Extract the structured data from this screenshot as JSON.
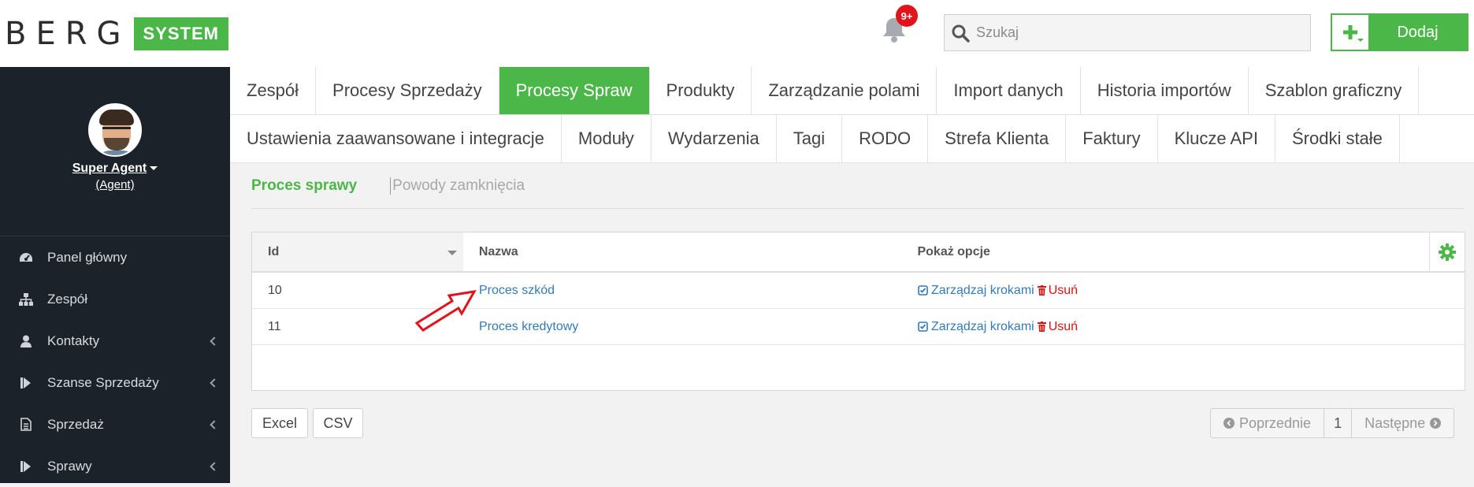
{
  "logo": {
    "part1": "BERG",
    "part2": "SYSTEM"
  },
  "user": {
    "name": "Super Agent",
    "role": "(Agent)"
  },
  "sidebar": {
    "items": [
      {
        "label": "Panel główny",
        "icon": "dashboard-icon"
      },
      {
        "label": "Zespół",
        "icon": "sitemap-icon"
      },
      {
        "label": "Kontakty",
        "icon": "user-icon"
      },
      {
        "label": "Szanse Sprzedaży",
        "icon": "step-forward-icon"
      },
      {
        "label": "Sprzedaż",
        "icon": "document-icon"
      },
      {
        "label": "Sprawy",
        "icon": "step-forward-icon"
      }
    ]
  },
  "topbar": {
    "notifications_badge": "9+",
    "search_placeholder": "Szukaj",
    "add_label": "Dodaj"
  },
  "tabs": {
    "row1": [
      "Zespół",
      "Procesy Sprzedaży",
      "Procesy Spraw",
      "Produkty",
      "Zarządzanie polami",
      "Import danych",
      "Historia importów",
      "Szablon graficzny"
    ],
    "row2": [
      "Ustawienia zaawansowane i integracje",
      "Moduły",
      "Wydarzenia",
      "Tagi",
      "RODO",
      "Strefa Klienta",
      "Faktury",
      "Klucze API",
      "Środki stałe"
    ],
    "active": "Procesy Spraw"
  },
  "subtabs": {
    "active": "Proces sprawy",
    "inactive": "Powody zamknięcia"
  },
  "table": {
    "headers": {
      "id": "Id",
      "name": "Nazwa",
      "options": "Pokaż opcje"
    },
    "rows": [
      {
        "id": "10",
        "name": "Proces szkód",
        "manage": "Zarządzaj krokami",
        "delete": "Usuń"
      },
      {
        "id": "11",
        "name": "Proces kredytowy",
        "manage": "Zarządzaj krokami",
        "delete": "Usuń"
      }
    ]
  },
  "export": {
    "excel": "Excel",
    "csv": "CSV"
  },
  "pagination": {
    "prev": "Poprzednie",
    "page": "1",
    "next": "Następne"
  },
  "colors": {
    "accent": "#4cb749",
    "sidebar": "#1c222a",
    "link": "#337ab7",
    "danger": "#d9140f"
  }
}
